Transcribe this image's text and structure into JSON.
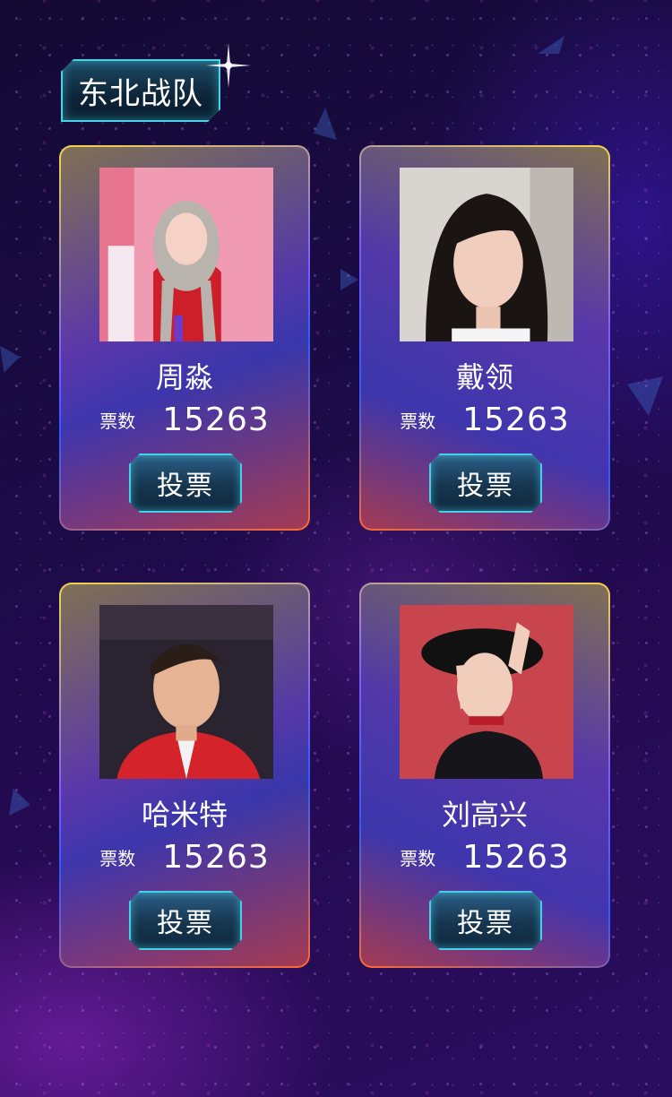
{
  "team": {
    "title": "东北战队"
  },
  "contestants": [
    {
      "name": "周淼",
      "votes_label": "票数",
      "votes": "15263",
      "vote_button": "投票"
    },
    {
      "name": "戴领",
      "votes_label": "票数",
      "votes": "15263",
      "vote_button": "投票"
    },
    {
      "name": "哈米特",
      "votes_label": "票数",
      "votes": "15263",
      "vote_button": "投票"
    },
    {
      "name": "刘高兴",
      "votes_label": "票数",
      "votes": "15263",
      "vote_button": "投票"
    }
  ],
  "colors": {
    "accent_cyan": "#46cfe6",
    "card_border_gold": "#f2d64a",
    "card_border_orange": "#ff6a2e",
    "background_purple": "#1a0b45"
  }
}
